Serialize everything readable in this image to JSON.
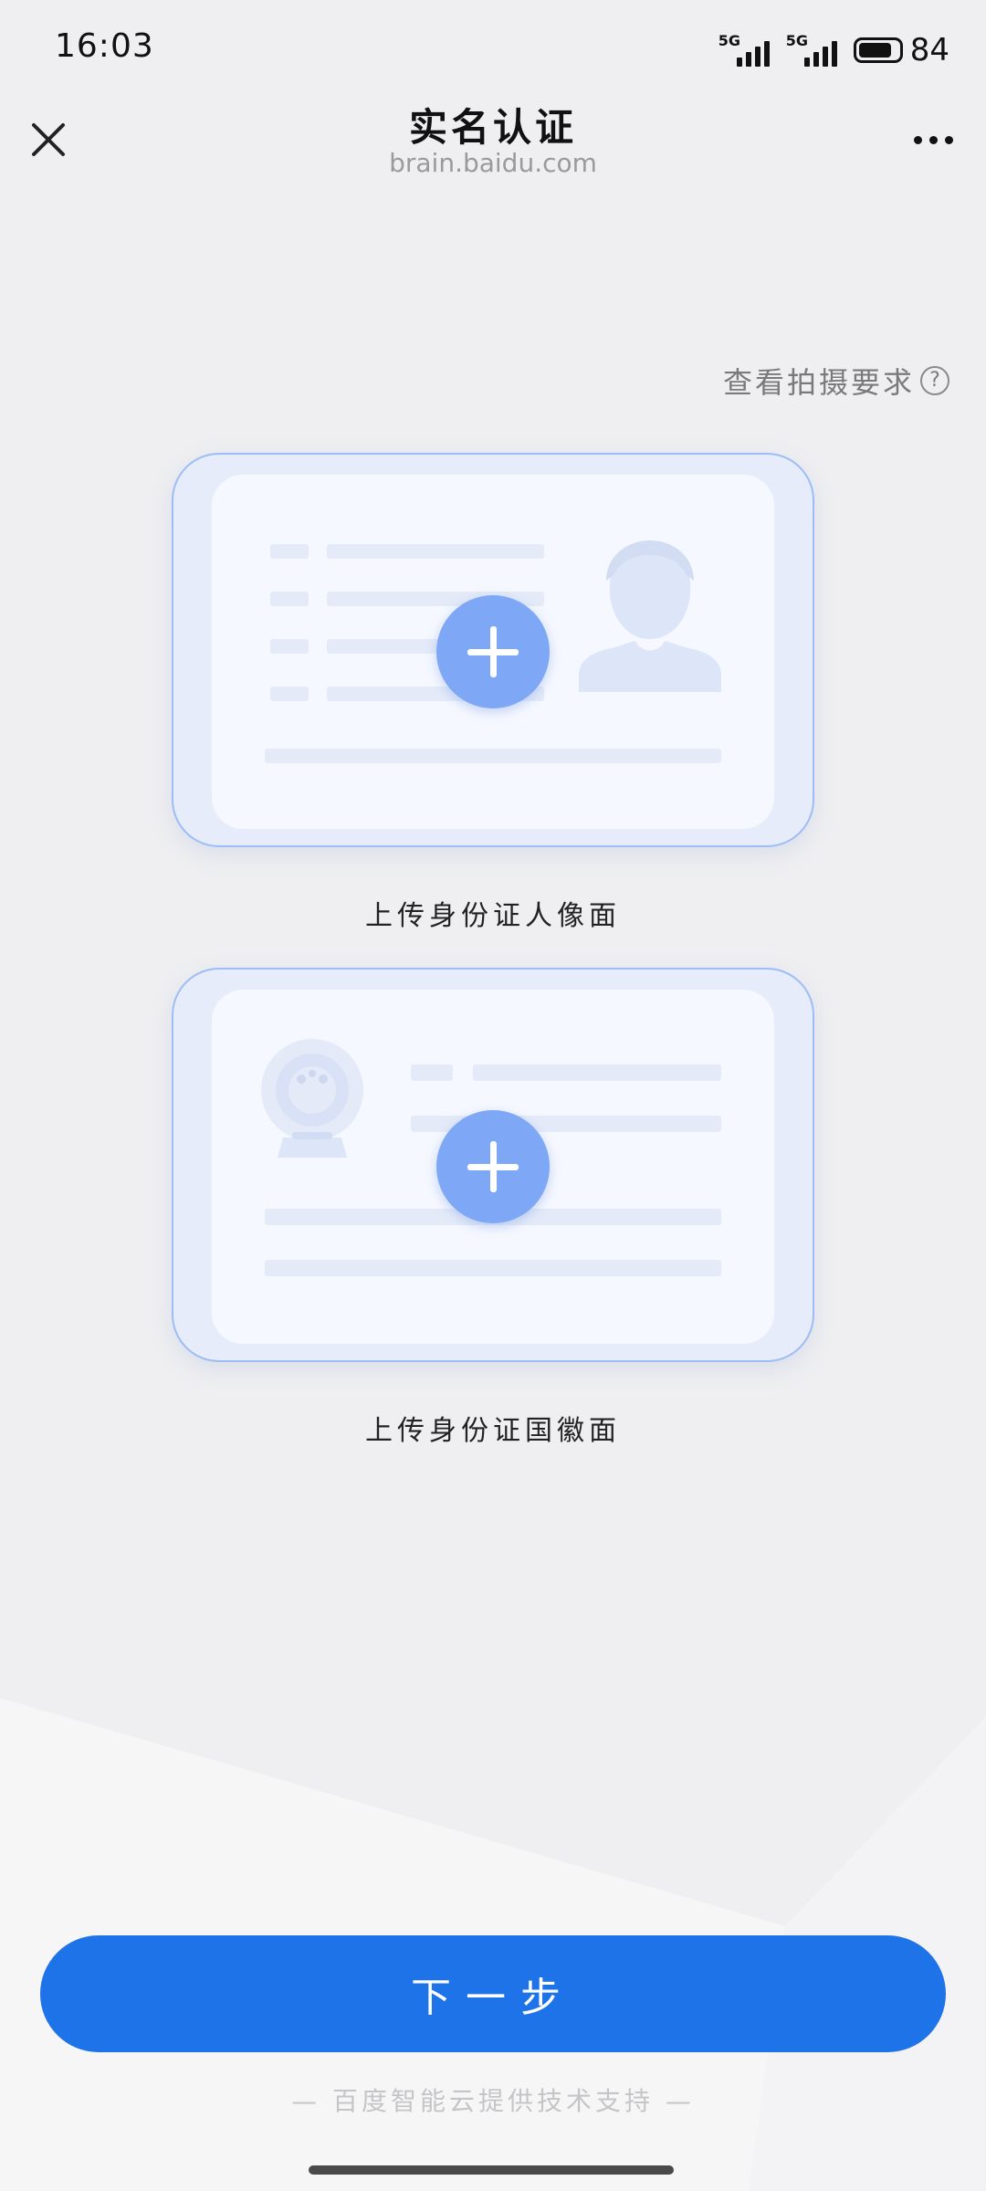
{
  "status_bar": {
    "time": "16:03",
    "network_1": "5G",
    "network_2": "5G",
    "battery_level": "84",
    "battery_fraction": 0.84
  },
  "header": {
    "title": "实名认证",
    "domain": "brain.baidu.com",
    "close_icon": "close-icon",
    "more_icon": "more-dots-icon"
  },
  "requirements": {
    "label": "查看拍摄要求",
    "help_symbol": "?"
  },
  "cards": [
    {
      "caption": "上传身份证人像面",
      "kind": "portrait-side",
      "action_icon": "plus-icon"
    },
    {
      "caption": "上传身份证国徽面",
      "kind": "emblem-side",
      "action_icon": "plus-icon"
    }
  ],
  "actions": {
    "next_label": "下一步"
  },
  "footer": {
    "credit": "— 百度智能云提供技术支持 —"
  },
  "colors": {
    "primary": "#1e73e8",
    "plus_button": "#7ea8f5",
    "card_border": "#9dbdf5",
    "background": "#efeff1"
  }
}
